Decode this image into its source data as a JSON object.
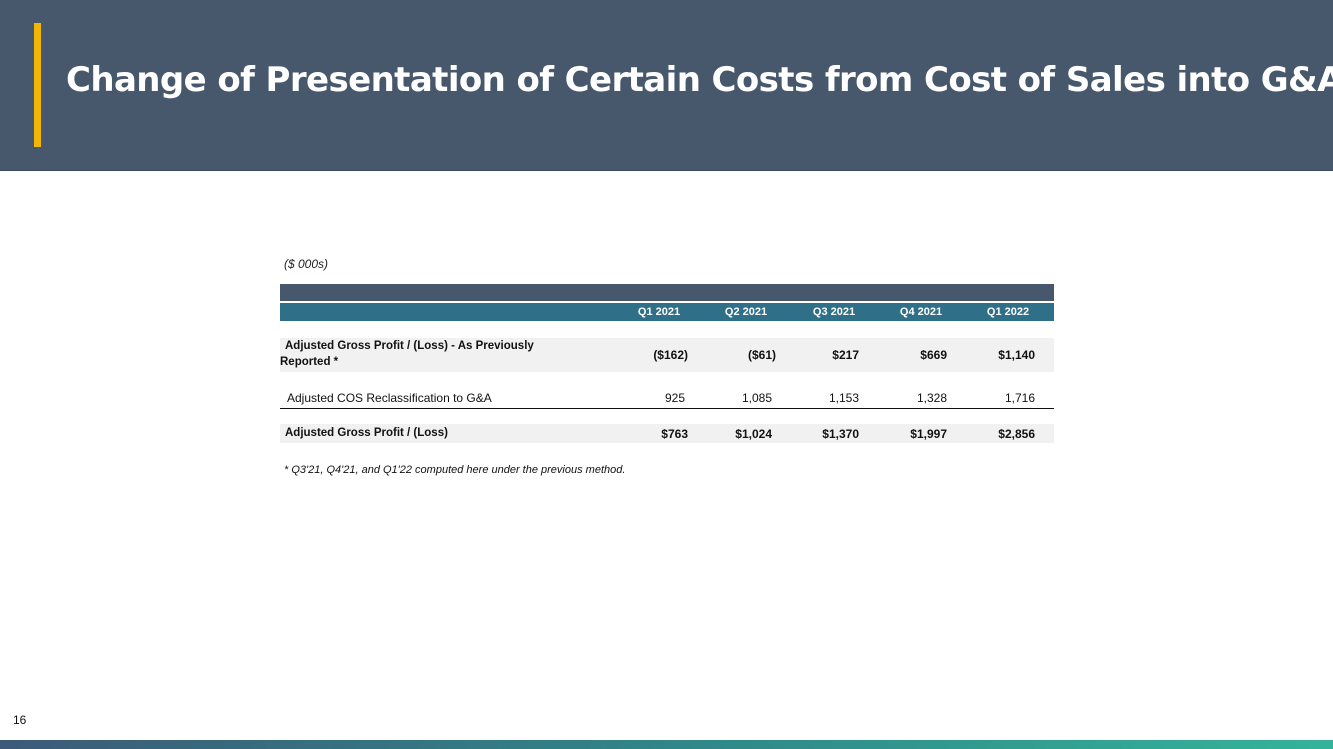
{
  "slide": {
    "title": "Change of Presentation of Certain Costs from Cost of Sales into G&A",
    "page_number": "16",
    "accent_color": "#f2b705",
    "header_color": "#48586c"
  },
  "table": {
    "units": "($ 000s)",
    "columns": [
      "Q1 2021",
      "Q2 2021",
      "Q3 2021",
      "Q4 2021",
      "Q1 2022"
    ],
    "rows": [
      {
        "label_line1": "Adjusted Gross Profit / (Loss) - As Previously",
        "label_line2": "Reported *",
        "values": [
          "($162)",
          "($61)",
          "$217",
          "$669",
          "$1,140"
        ]
      },
      {
        "label": "Adjusted COS Reclassification to G&A",
        "values": [
          "925",
          "1,085",
          "1,153",
          "1,328",
          "1,716"
        ]
      },
      {
        "label": "Adjusted Gross Profit / (Loss)",
        "values": [
          "$763",
          "$1,024",
          "$1,370",
          "$1,997",
          "$2,856"
        ]
      }
    ],
    "footnote": "* Q3'21, Q4'21, and Q1'22 computed here under the previous method."
  }
}
